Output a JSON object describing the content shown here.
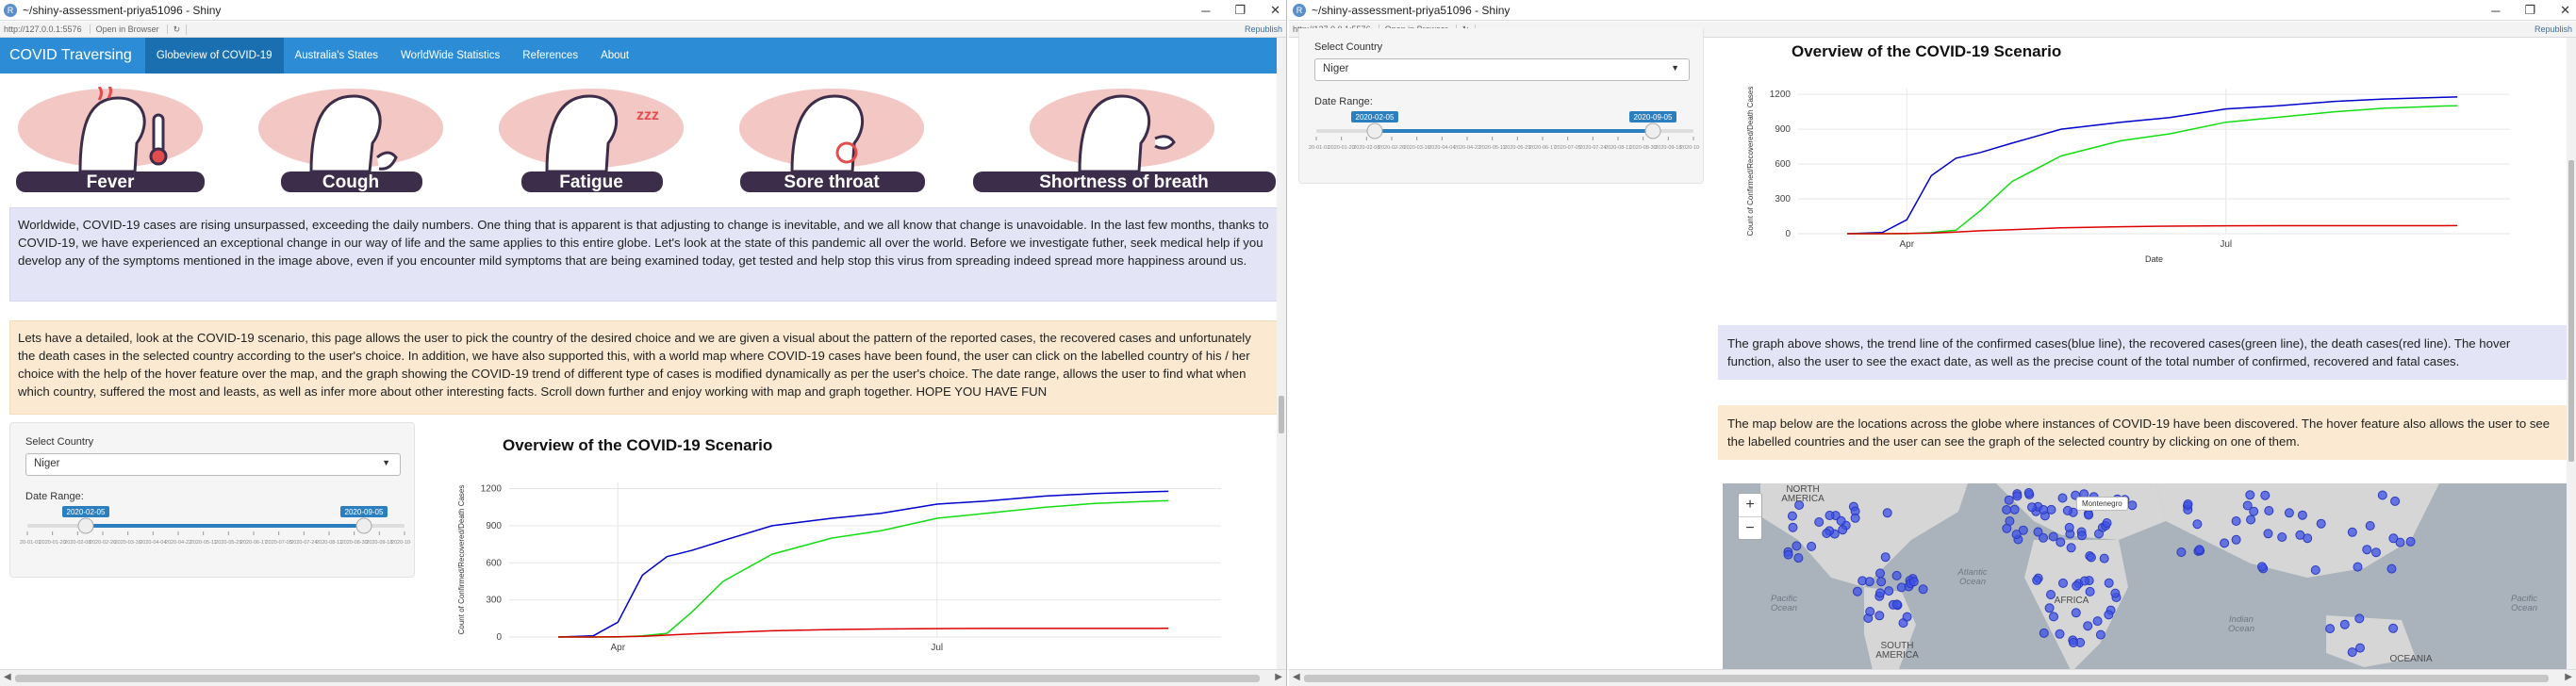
{
  "window_title": "~/shiny-assessment-priya51096 - Shiny",
  "address": {
    "url": "http://127.0.0.1:5576",
    "open_in_browser": "Open in Browser",
    "republish": "Republish"
  },
  "navbar": {
    "brand": "COVID Traversing",
    "items": [
      {
        "label": "Globeview of COVID-19",
        "active": true
      },
      {
        "label": "Australia's States",
        "active": false
      },
      {
        "label": "WorldWide Statistics",
        "active": false
      },
      {
        "label": "References",
        "active": false
      },
      {
        "label": "About",
        "active": false
      }
    ]
  },
  "symptoms": [
    "Fever",
    "Cough",
    "Fatigue",
    "Sore throat",
    "Shortness of breath"
  ],
  "intro_text": "Worldwide, COVID-19 cases are rising unsurpassed, exceeding the daily numbers. One thing that is apparent is that adjusting to change is inevitable, and we all know that change is unavoidable. In the last few months, thanks to COVID-19, we have experienced an exceptional change in our way of life and the same applies to this entire globe. Let's look at the state of this pandemic all over the world. Before we investigate futher, seek medical help if you develop any of the symptoms mentioned in the image above, even if you encounter mild symptoms that are being examined today, get tested and help stop this virus from spreading indeed spread more happiness around us.",
  "detail_text": "Lets have a detailed, look at the COVID-19 scenario, this page allows the user to pick the country of the desired choice and we are given a visual about the pattern of the reported cases, the recovered cases and unfortunately the death cases in the selected country according to the user's choice. In addition, we have also supported this, with a world map where COVID-19 cases have been found, the user can click on the labelled country of his / her choice with the help of the hover feature over the map, and the graph showing the COVID-19 trend of different type of cases is modified dynamically as per the user's choice. The date range, allows the user to find what when which country, suffered the most and leasts, as well as infer more about other interesting facts. Scroll down further and enjoy working with map and graph together. HOPE YOU HAVE FUN",
  "controls": {
    "country_label": "Select Country",
    "country_value": "Niger",
    "date_label": "Date Range:",
    "date_from": "2020-02-05",
    "date_to": "2020-09-05",
    "ticks": [
      "2020-01-01",
      "2020-01-20",
      "2020-02-08",
      "2020-02-26",
      "2020-03-16",
      "2020-04-04",
      "2020-04-22",
      "2020-05-11",
      "2020-05-29",
      "2020-06-17",
      "2020-07-05",
      "2020-07-24",
      "2020-08-11",
      "2020-08-30",
      "2020-09-18",
      "2020-10-06"
    ]
  },
  "plot": {
    "title": "Overview of the COVID-19 Scenario",
    "ylabel": "Count of Confirmed/Recovered/Death Cases",
    "xlabel": "Date",
    "yticks": [
      "0",
      "300",
      "600",
      "900",
      "1200"
    ],
    "xticks": [
      "Apr",
      "Jul"
    ]
  },
  "chart_data": {
    "type": "line",
    "title": "Overview of the COVID-19 Scenario",
    "xlabel": "Date",
    "ylabel": "Count of Confirmed/Recovered/Death Cases",
    "ylim": [
      0,
      1250
    ],
    "x": [
      "2020-03-15",
      "2020-03-25",
      "2020-04-01",
      "2020-04-08",
      "2020-04-15",
      "2020-04-22",
      "2020-05-01",
      "2020-05-15",
      "2020-06-01",
      "2020-06-15",
      "2020-07-01",
      "2020-07-15",
      "2020-08-01",
      "2020-08-15",
      "2020-09-01",
      "2020-09-05"
    ],
    "series": [
      {
        "name": "confirmed",
        "color": "#0000cc",
        "values": [
          0,
          10,
          120,
          500,
          650,
          700,
          780,
          900,
          960,
          1000,
          1075,
          1100,
          1140,
          1160,
          1175,
          1178
        ]
      },
      {
        "name": "recovered",
        "color": "#11dd11",
        "values": [
          0,
          0,
          0,
          10,
          30,
          200,
          450,
          670,
          800,
          860,
          960,
          1000,
          1050,
          1080,
          1100,
          1102
        ]
      },
      {
        "name": "deaths",
        "color": "#dd0000",
        "values": [
          0,
          0,
          2,
          5,
          15,
          25,
          35,
          50,
          60,
          65,
          68,
          69,
          69,
          69,
          69,
          70
        ]
      }
    ]
  },
  "right_text1": "The graph above shows, the trend line of the confirmed cases(blue line), the recovered cases(green line), the death cases(red line). The hover function, also the user to see the exact date, as well as the precise count of the total number of confirmed, recovered and fatal cases.",
  "right_text2": "The map below are the locations across the globe where instances of COVID-19 have been discovered. The hover feature also allows the user to see the labelled countries and the user can see the graph of the selected country by clicking on one of them.",
  "map": {
    "labels": [
      "NORTH AMERICA",
      "SOUTH AMERICA",
      "AFRICA",
      "OCEANIA"
    ],
    "oceans": [
      "Pacific Ocean",
      "Atlantic Ocean",
      "Indian Ocean",
      "Pacific Ocean"
    ],
    "tooltip": "Montenegro",
    "zoom_in": "+",
    "zoom_out": "−"
  },
  "colors": {
    "navbar": "#2c8dd6",
    "banner_blue": "#e3e4f5",
    "banner_orange": "#fbe9d1",
    "marker": "#3f51e6",
    "land": "#d5d5d5",
    "water": "#aab3bb"
  }
}
